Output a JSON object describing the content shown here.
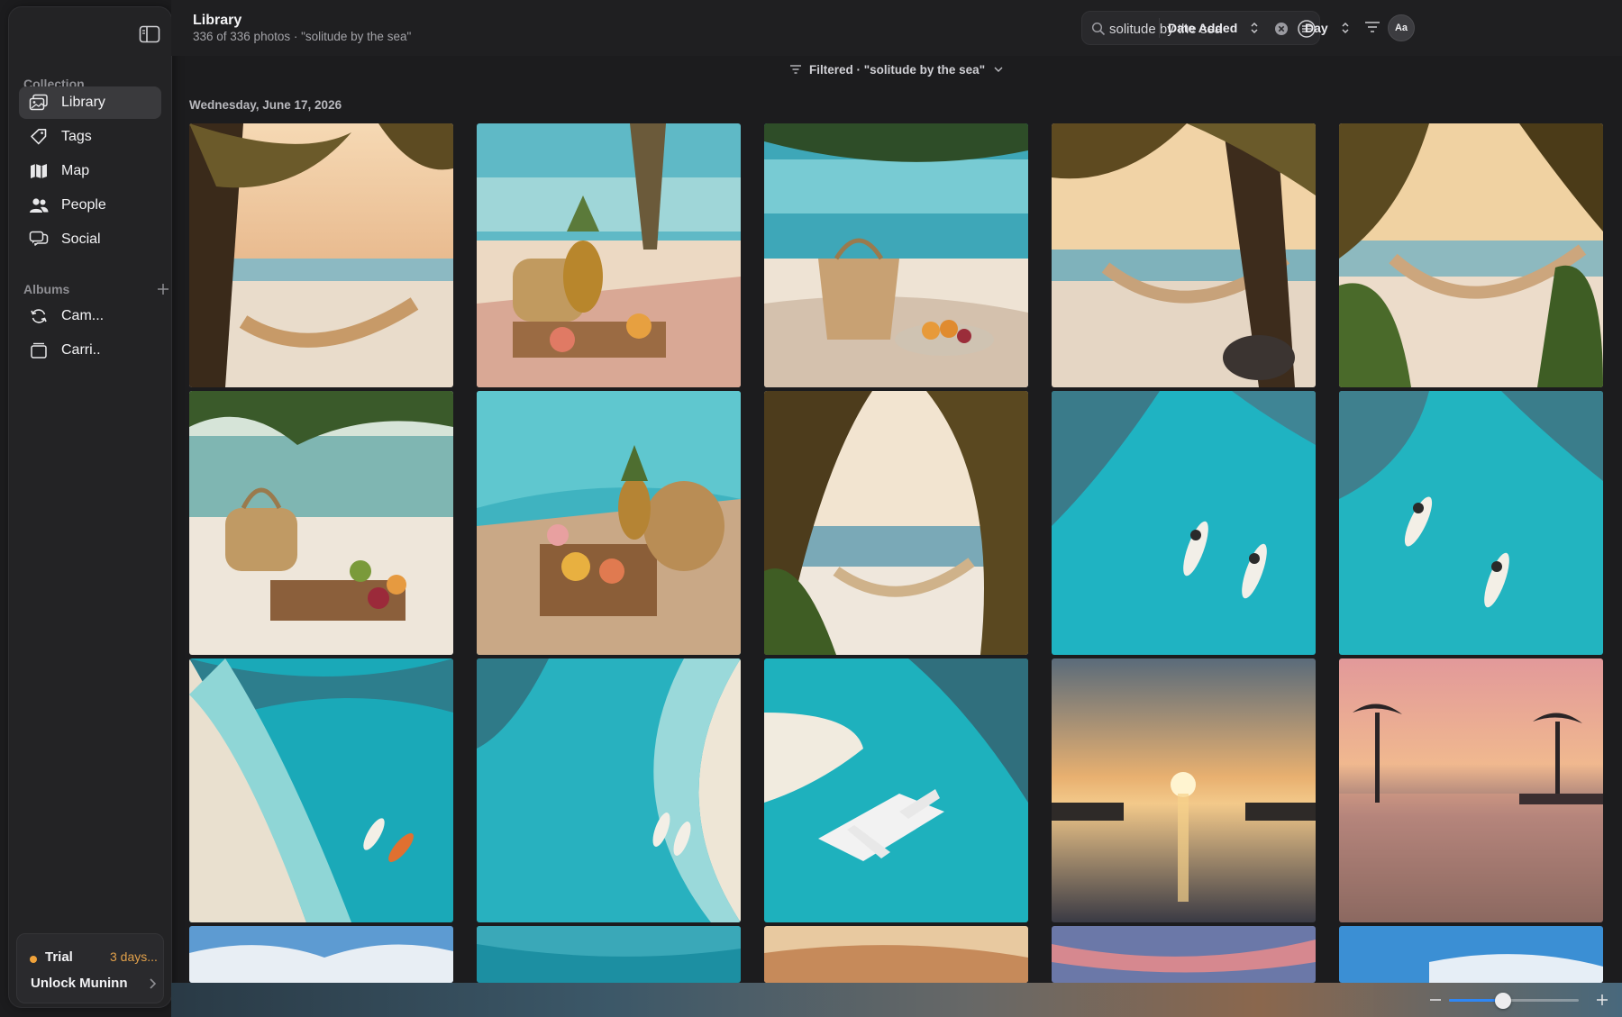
{
  "sidebar": {
    "collection_label": "Collection",
    "albums_label": "Albums",
    "items": [
      {
        "label": "Library",
        "icon": "photo-library-icon"
      },
      {
        "label": "Tags",
        "icon": "tag-icon"
      },
      {
        "label": "Map",
        "icon": "map-icon"
      },
      {
        "label": "People",
        "icon": "people-icon"
      },
      {
        "label": "Social",
        "icon": "social-icon"
      }
    ],
    "albums": [
      {
        "label": "Cam...",
        "icon": "sync-icon"
      },
      {
        "label": "Carri..",
        "icon": "folder-icon"
      }
    ],
    "trial": {
      "label": "Trial",
      "days": "3 days...",
      "unlock": "Unlock Muninn"
    }
  },
  "header": {
    "title": "Library",
    "subtitle": "336 of 336 photos · \"solitude by the sea\"",
    "search_value": "solitude by the sea",
    "sort_label": "Date Added",
    "group_label": "Day",
    "avatar": "Aa"
  },
  "filter_bar": {
    "text": "Filtered · \"solitude by the sea\""
  },
  "date_heading": "Wednesday, June 17, 2026",
  "zoom": {
    "level": 0.42
  },
  "colors": {
    "accent": "#2f8cff",
    "trial_dot": "#f0a23a",
    "background": "#1c1c1e"
  }
}
